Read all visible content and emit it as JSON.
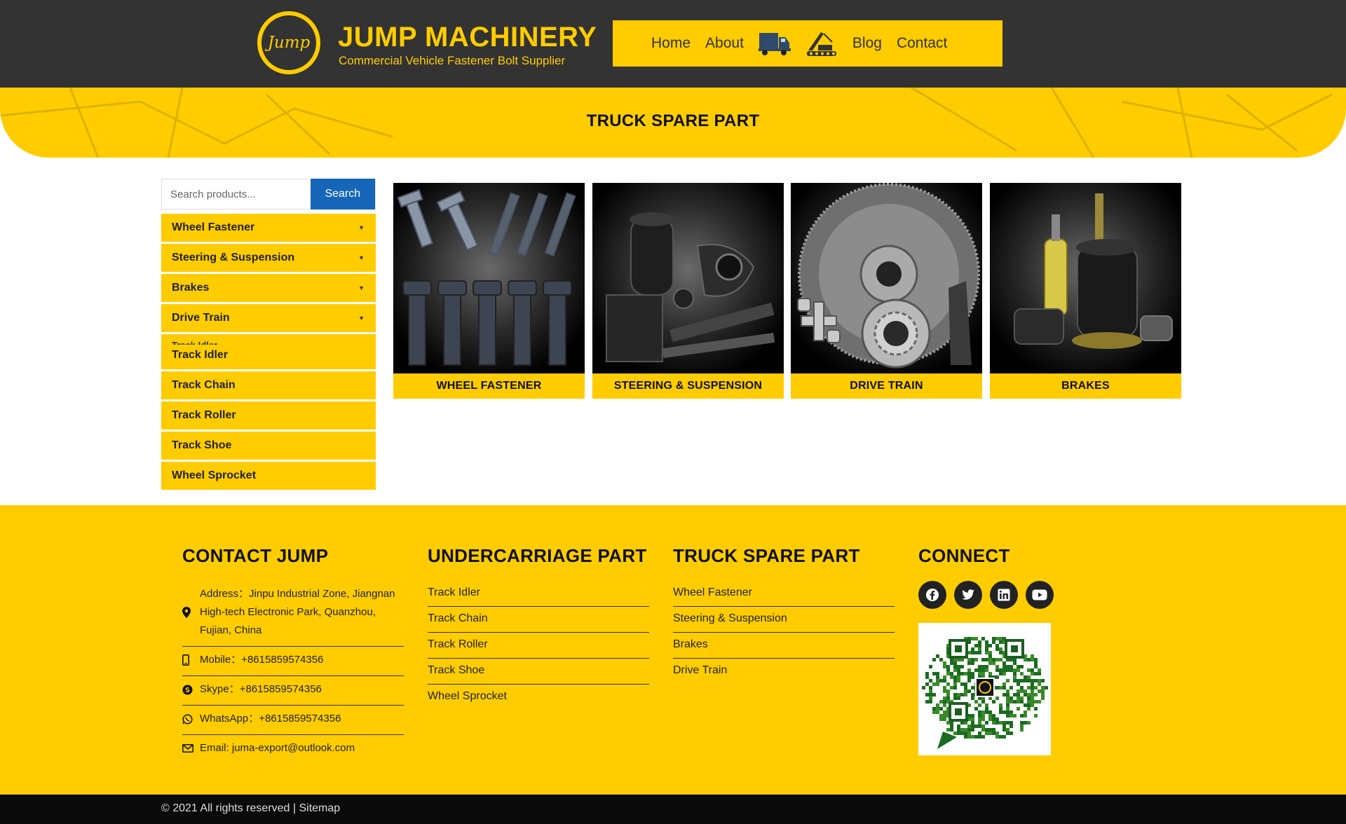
{
  "header": {
    "logo_text": "Jump",
    "brand_title": "JUMP MACHINERY",
    "brand_subtitle": "Commercial Vehicle Fastener Bolt Supplier",
    "nav": {
      "home": "Home",
      "about": "About",
      "truck_icon": "truck-icon",
      "crane_icon": "crane-icon",
      "blog": "Blog",
      "contact": "Contact"
    },
    "colors": {
      "bar": "#333333",
      "accent": "#FFCC00"
    }
  },
  "hero": {
    "title": "TRUCK SPARE PART"
  },
  "sidebar": {
    "search_placeholder": "Search products...",
    "search_button": "Search",
    "categories": [
      {
        "label": "Wheel Fastener",
        "has_children": true
      },
      {
        "label": "Steering & Suspension",
        "has_children": true
      },
      {
        "label": "Brakes",
        "has_children": true
      },
      {
        "label": "Drive Train",
        "has_children": true
      },
      {
        "label": "Track Idler",
        "has_children": false
      },
      {
        "label": "Track Chain",
        "has_children": false
      },
      {
        "label": "Track Roller",
        "has_children": false
      },
      {
        "label": "Track Shoe",
        "has_children": false
      },
      {
        "label": "Wheel Sprocket",
        "has_children": false
      }
    ],
    "caret": "▼"
  },
  "products": [
    {
      "label": "WHEEL FASTENER",
      "icon": "bolts-image"
    },
    {
      "label": "STEERING & SUSPENSION",
      "icon": "suspension-parts-image"
    },
    {
      "label": "DRIVE TRAIN",
      "icon": "flywheel-image"
    },
    {
      "label": "BRAKES",
      "icon": "brake-chamber-image"
    }
  ],
  "footer": {
    "contact": {
      "heading": "CONTACT JUMP",
      "address": "Address：Jinpu Industrial Zone, Jiangnan High-tech Electronic Park, Quanzhou, Fujian, China",
      "mobile": "Mobile：+8615859574356",
      "skype": "Skype：+8615859574356",
      "whatsapp": "WhatsApp：+8615859574356",
      "email": "Email: juma-export@outlook.com"
    },
    "undercarriage": {
      "heading": "UNDERCARRIAGE PART",
      "links": [
        "Track Idler",
        "Track Chain",
        "Track Roller",
        "Track Shoe",
        "Wheel Sprocket"
      ]
    },
    "truck": {
      "heading": "TRUCK SPARE PART",
      "links": [
        "Wheel Fastener",
        "Steering & Suspension",
        "Brakes",
        "Drive Train"
      ]
    },
    "connect": {
      "heading": "CONNECT",
      "social": [
        "facebook-icon",
        "twitter-icon",
        "linkedin-icon",
        "youtube-icon"
      ],
      "qr": "wechat-qr-code"
    }
  },
  "bottom": {
    "copyright": "© 2021 All rights reserved | Sitemap"
  }
}
